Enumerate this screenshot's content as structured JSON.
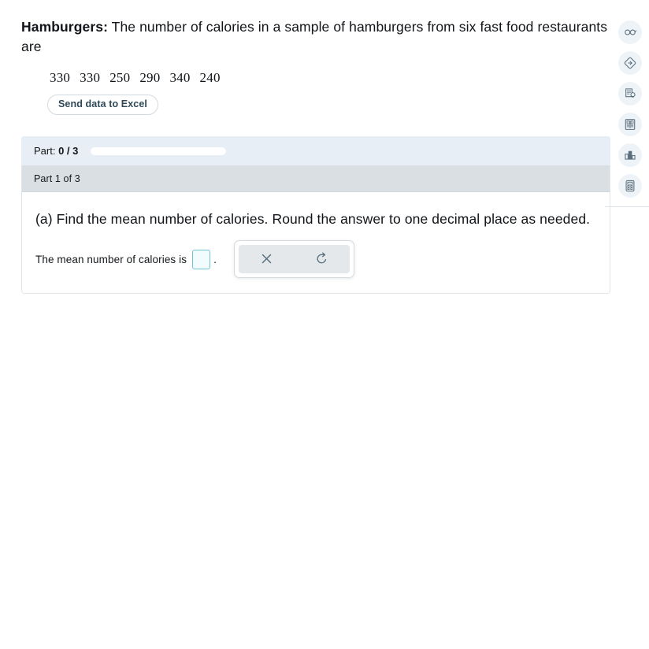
{
  "problem": {
    "lead": "Hamburgers:",
    "statement": " The number of calories in a sample of hamburgers from six fast food restaurants are",
    "values": [
      "330",
      "330",
      "250",
      "290",
      "340",
      "240"
    ],
    "excel_button": "Send data to Excel"
  },
  "progress": {
    "label_prefix": "Part:",
    "current": "0 / 3",
    "percent": 0
  },
  "card": {
    "header": "Part 1 of 3",
    "question": "(a) Find the mean number of calories. Round the answer to one decimal place as needed.",
    "answer_label": "The mean number of calories is",
    "answer_value": "",
    "answer_placeholder": "",
    "answer_period": "."
  },
  "math_toolbar": {
    "buttons": [
      {
        "name": "clear-button",
        "icon": "close-icon",
        "label": "×"
      },
      {
        "name": "undo-button",
        "icon": "undo-icon",
        "label": "↺"
      }
    ]
  },
  "sidebar": {
    "items": [
      {
        "name": "sidebar-item-glasses",
        "icon": "glasses-icon"
      },
      {
        "name": "sidebar-item-navigate",
        "icon": "diamond-arrow-icon"
      },
      {
        "name": "sidebar-item-hint",
        "icon": "document-lightbulb-icon"
      },
      {
        "name": "sidebar-item-ebook",
        "icon": "book-icon"
      },
      {
        "name": "sidebar-item-statistics",
        "icon": "bar-chart-icon"
      },
      {
        "name": "sidebar-item-calculator",
        "icon": "calculator-icon"
      }
    ]
  },
  "colors": {
    "strip_bg": "#e8eef5",
    "card_header_bg": "#d9dfe2",
    "input_border": "#72c5d6",
    "sidebar_icon_bg": "#eef3f7",
    "icon_stroke": "#5b6f7d"
  }
}
